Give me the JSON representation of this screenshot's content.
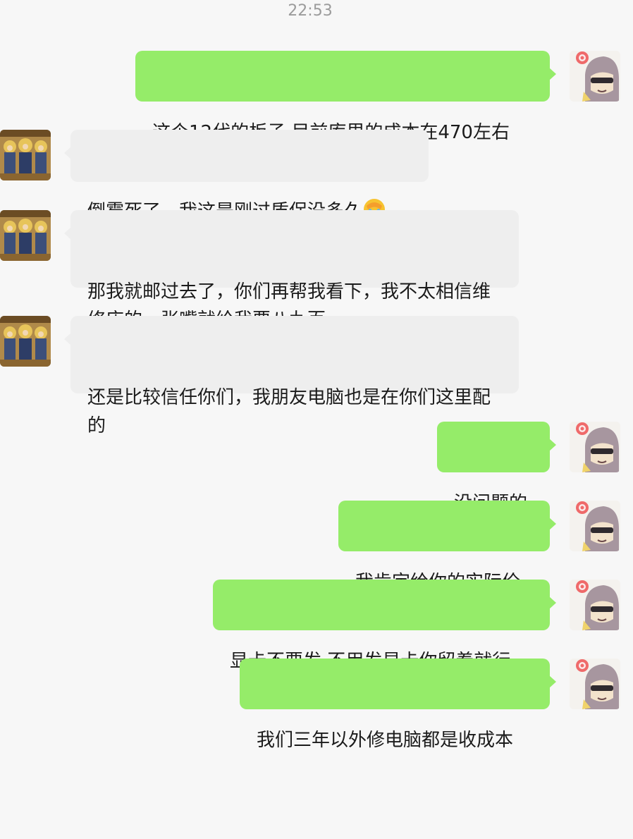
{
  "chat": {
    "timestamp": "22:53",
    "messages": [
      {
        "side": "out",
        "text": "这个12代的板子 目前库里的成本在470左右"
      },
      {
        "side": "in",
        "text": "倒霉死了，我这是刚过质保没多久",
        "emoji": "face-palm-emoji"
      },
      {
        "side": "in",
        "text": "那我就邮过去了，你们再帮我看下，我不太相信维修店的，张嘴就给我要八九百"
      },
      {
        "side": "in",
        "text": "还是比较信任你们，我朋友电脑也是在你们这里配的"
      },
      {
        "side": "out",
        "text": "没问题的"
      },
      {
        "side": "out",
        "text": "我肯定给你的实际价"
      },
      {
        "side": "out",
        "text": "显卡不要发 不用发显卡你留着就行"
      },
      {
        "side": "out",
        "text": "我们三年以外修电脑都是收成本"
      }
    ]
  },
  "colors": {
    "background": "#f7f7f7",
    "outgoing_bubble": "#95ec69",
    "incoming_bubble": "#eeeeee",
    "timestamp_text": "#9b9b9b"
  },
  "avatars": {
    "self": "anime-character-avatar",
    "contact": "religious-painting-avatar"
  }
}
